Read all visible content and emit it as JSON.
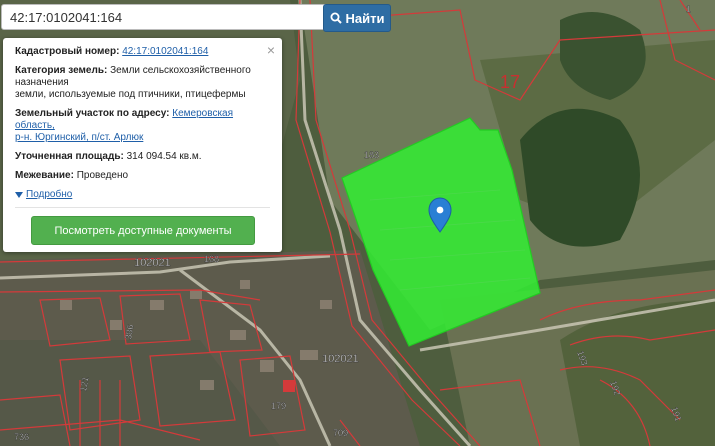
{
  "search": {
    "value": "42:17:0102041:164",
    "button_label": "Найти"
  },
  "popup": {
    "cadastral_label": "Кадастровый номер:",
    "cadastral_value": "42:17:0102041:164",
    "category_label": "Категория земель:",
    "category_value_1": "Земли сельскохозяйственного",
    "category_value_2": "назначения",
    "category_value_3": "земли, используемые под птичники, птицефермы",
    "address_label": "Земельный участок по адресу:",
    "address_value_1": "Кемеровская область,",
    "address_value_2": "р-н. Юргинский, п/ст. Арлюк",
    "area_label": "Уточненная площадь:",
    "area_value": "314 094.54 кв.м.",
    "survey_label": "Межевание:",
    "survey_value": "Проведено",
    "more_link": "Подробно",
    "docs_button": "Посмотреть доступные документы",
    "close_glyph": "×"
  },
  "map_labels": {
    "quarter_17": "17",
    "quarter_102021_a": "102021",
    "quarter_102021_b": "102021",
    "n168": "168",
    "n183": "183",
    "n386": "386",
    "n121": "121",
    "n179": "179",
    "n709": "709",
    "n736": "736",
    "n193": "193",
    "n192": "192",
    "n191": "191",
    "n1": "1"
  },
  "colors": {
    "parcel_fill": "#33ee33",
    "boundary": "#d43a3a",
    "button_blue": "#2e6da4",
    "button_green": "#52b04f",
    "marker": "#2a7fd4"
  }
}
